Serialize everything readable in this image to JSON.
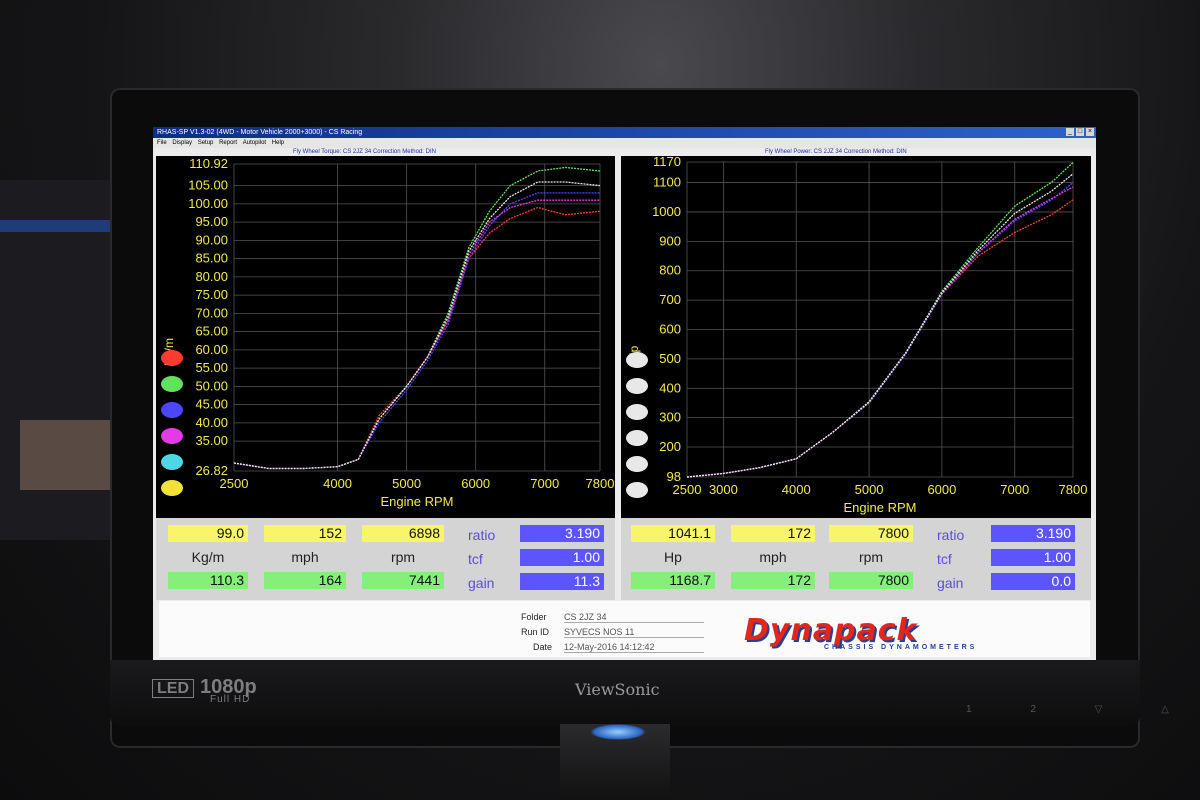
{
  "window": {
    "title": "RHAS-SP V1.3-02  (4WD - Motor Vehicle 2000+3000) - CS Racing",
    "menu": [
      "File",
      "Display",
      "Setup",
      "Report",
      "Autopilot",
      "Help"
    ],
    "controls": [
      "_",
      "□",
      "×"
    ]
  },
  "torque_panel": {
    "title": "Fly Wheel Torque: CS 2JZ 34      Correction Method: DIN",
    "ylabel": "Kg/m",
    "xlabel": "Engine RPM"
  },
  "power_panel": {
    "title": "Fly Wheel Power: CS 2JZ 34      Correction Method: DIN",
    "ylabel": "Hp",
    "xlabel": "Engine RPM"
  },
  "torque_readout": {
    "top": [
      "99.0",
      "152",
      "6898"
    ],
    "labels": [
      "Kg/m",
      "mph",
      "rpm"
    ],
    "bottom": [
      "110.3",
      "164",
      "7441"
    ],
    "ratio_label": "ratio",
    "ratio": "3.190",
    "tcf_label": "tcf",
    "tcf": "1.00",
    "gain_label": "gain",
    "gain": "11.3"
  },
  "power_readout": {
    "top": [
      "1041.1",
      "172",
      "7800"
    ],
    "labels": [
      "Hp",
      "mph",
      "rpm"
    ],
    "bottom": [
      "1168.7",
      "172",
      "7800"
    ],
    "ratio_label": "ratio",
    "ratio": "3.190",
    "tcf_label": "tcf",
    "tcf": "1.00",
    "gain_label": "gain",
    "gain": "0.0"
  },
  "footer": {
    "folder_label": "Folder",
    "folder": "CS 2JZ 34",
    "runid_label": "Run ID",
    "runid": "SYVECS NOS 11",
    "date_label": "Date",
    "date": "12-May-2016  14:12:42",
    "logo": "Dynapack",
    "logo_sub": "CHASSIS DYNAMOMETERS"
  },
  "monitor": {
    "brand": "ViewSonic",
    "badge_led": "LED",
    "badge_res": "1080p",
    "badge_fhd": "Full HD"
  },
  "legend_colors": [
    "#ff3b2f",
    "#5fe35a",
    "#4b46ff",
    "#e33be5",
    "#4fd6e6",
    "#f3e13a"
  ],
  "chart_data": [
    {
      "type": "line",
      "title": "Fly Wheel Torque: CS 2JZ 34",
      "xlabel": "Engine RPM",
      "ylabel": "Kg/m",
      "xlim": [
        2500,
        7800
      ],
      "ylim": [
        26.82,
        110.92
      ],
      "xticks": [
        2500,
        4000,
        5000,
        6000,
        7000,
        7800
      ],
      "yticks": [
        26.82,
        35,
        40,
        45,
        50,
        55,
        60,
        65,
        70,
        75,
        80,
        85,
        90,
        95,
        100,
        105,
        110.92
      ],
      "grid": true,
      "series": [
        {
          "color": "#ff3b2f",
          "x": [
            2500,
            3000,
            3500,
            4000,
            4300,
            4600,
            5000,
            5300,
            5600,
            5900,
            6200,
            6500,
            6900,
            7300,
            7800
          ],
          "y": [
            29,
            27.5,
            27.5,
            28,
            30,
            42,
            50,
            58,
            68,
            85,
            92,
            96,
            99,
            97,
            98
          ]
        },
        {
          "color": "#5fe35a",
          "x": [
            2500,
            3000,
            3500,
            4000,
            4300,
            4600,
            5000,
            5300,
            5600,
            5900,
            6200,
            6500,
            6900,
            7300,
            7800
          ],
          "y": [
            29,
            27.5,
            27.5,
            28,
            30,
            41,
            50,
            58,
            70,
            88,
            98,
            105,
            109,
            110,
            109
          ]
        },
        {
          "color": "#4b46ff",
          "x": [
            2500,
            3000,
            3500,
            4000,
            4300,
            4600,
            5000,
            5300,
            5600,
            5900,
            6200,
            6500,
            6900,
            7300,
            7800
          ],
          "y": [
            29,
            27.5,
            27.5,
            28,
            30,
            40,
            49,
            57,
            67,
            85,
            94,
            100,
            103,
            103,
            103
          ]
        },
        {
          "color": "#e33be5",
          "x": [
            2500,
            3000,
            3500,
            4000,
            4300,
            4600,
            5000,
            5300,
            5600,
            5900,
            6200,
            6500,
            6900,
            7300,
            7800
          ],
          "y": [
            29,
            27.5,
            27.5,
            28,
            30,
            41,
            50,
            58,
            68,
            86,
            95,
            99,
            101,
            101,
            101
          ]
        },
        {
          "color": "#e9e9e9",
          "x": [
            2500,
            3000,
            3500,
            4000,
            4300,
            4600,
            5000,
            5300,
            5600,
            5900,
            6200,
            6500,
            6900,
            7300,
            7800
          ],
          "y": [
            29,
            27.5,
            27.5,
            28,
            30,
            41,
            50,
            58,
            69,
            87,
            96,
            102,
            106,
            106,
            105
          ]
        }
      ]
    },
    {
      "type": "line",
      "title": "Fly Wheel Power: CS 2JZ 34",
      "xlabel": "Engine RPM",
      "ylabel": "Hp",
      "xlim": [
        2500,
        7800
      ],
      "ylim": [
        98,
        1170
      ],
      "xticks": [
        2500,
        3000,
        4000,
        5000,
        6000,
        7000,
        7800
      ],
      "yticks": [
        98,
        200,
        300,
        400,
        500,
        600,
        700,
        800,
        900,
        1000,
        1100,
        1170
      ],
      "grid": true,
      "series": [
        {
          "color": "#ff3b2f",
          "x": [
            2500,
            3000,
            3500,
            4000,
            4500,
            5000,
            5500,
            6000,
            6500,
            7000,
            7500,
            7800
          ],
          "y": [
            98,
            110,
            130,
            160,
            250,
            350,
            520,
            720,
            850,
            930,
            990,
            1041
          ]
        },
        {
          "color": "#5fe35a",
          "x": [
            2500,
            3000,
            3500,
            4000,
            4500,
            5000,
            5500,
            6000,
            6500,
            7000,
            7500,
            7800
          ],
          "y": [
            98,
            110,
            130,
            160,
            250,
            355,
            520,
            730,
            880,
            1020,
            1100,
            1168
          ]
        },
        {
          "color": "#4b46ff",
          "x": [
            2500,
            3000,
            3500,
            4000,
            4500,
            5000,
            5500,
            6000,
            6500,
            7000,
            7500,
            7800
          ],
          "y": [
            98,
            110,
            130,
            160,
            250,
            350,
            515,
            720,
            860,
            970,
            1040,
            1100
          ]
        },
        {
          "color": "#e33be5",
          "x": [
            2500,
            3000,
            3500,
            4000,
            4500,
            5000,
            5500,
            6000,
            6500,
            7000,
            7500,
            7800
          ],
          "y": [
            98,
            110,
            130,
            160,
            250,
            352,
            518,
            722,
            862,
            975,
            1045,
            1085
          ]
        },
        {
          "color": "#e9e9e9",
          "x": [
            2500,
            3000,
            3500,
            4000,
            4500,
            5000,
            5500,
            6000,
            6500,
            7000,
            7500,
            7800
          ],
          "y": [
            98,
            110,
            130,
            160,
            250,
            353,
            519,
            725,
            870,
            995,
            1070,
            1130
          ]
        }
      ]
    }
  ]
}
